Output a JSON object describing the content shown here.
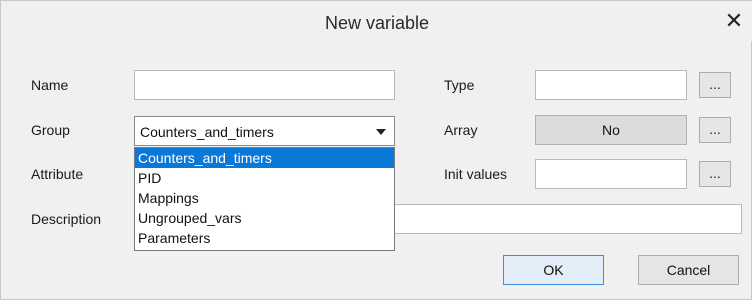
{
  "dialog": {
    "title": "New variable",
    "close_glyph": "✕"
  },
  "labels": {
    "name": "Name",
    "group": "Group",
    "attribute": "Attribute",
    "description": "Description",
    "type": "Type",
    "array": "Array",
    "init_values": "Init values"
  },
  "fields": {
    "name_value": "",
    "type_value": "",
    "init_values_value": "",
    "description_value": "",
    "group_selected": "Counters_and_timers",
    "array_value": "No"
  },
  "ellipsis": "...",
  "group_options": [
    {
      "label": "Counters_and_timers",
      "selected": true
    },
    {
      "label": "PID",
      "selected": false
    },
    {
      "label": "Mappings",
      "selected": false
    },
    {
      "label": "Ungrouped_vars",
      "selected": false
    },
    {
      "label": "Parameters",
      "selected": false
    }
  ],
  "buttons": {
    "ok": "OK",
    "cancel": "Cancel"
  },
  "colors": {
    "selection": "#0a78d7",
    "ok_border": "#3c8fdc",
    "dialog_bg": "#f0f0f0"
  }
}
